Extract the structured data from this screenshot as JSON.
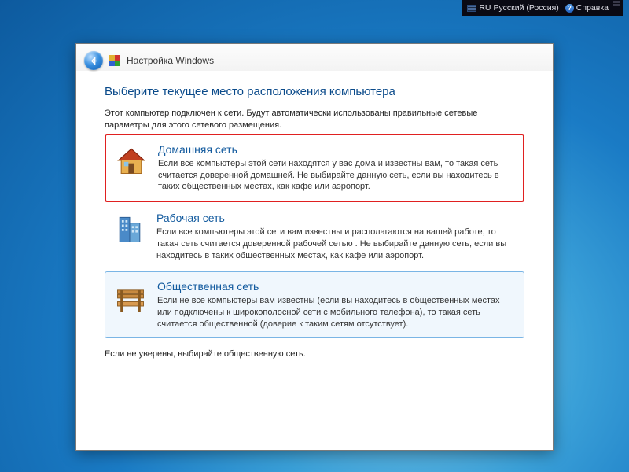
{
  "topbar": {
    "lang_code": "RU",
    "lang_label": "Русский (Россия)",
    "help_label": "Справка"
  },
  "dialog": {
    "title": "Настройка Windows",
    "heading": "Выберите текущее место расположения компьютера",
    "intro": "Этот компьютер подключен к сети. Будут автоматически использованы правильные сетевые параметры для этого сетевого размещения.",
    "options": [
      {
        "title": "Домашняя сеть",
        "desc": "Если все компьютеры этой сети находятся у вас дома и известны вам, то такая сеть считается доверенной домашней. Не выбирайте данную сеть, если вы находитесь в таких общественных местах, как кафе или аэропорт."
      },
      {
        "title": "Рабочая сеть",
        "desc": "Если все компьютеры этой сети вам известны и располагаются на вашей работе, то такая сеть считается доверенной рабочей сетью . Не выбирайте данную сеть, если вы находитесь в таких общественных местах, как кафе или аэропорт."
      },
      {
        "title": "Общественная сеть",
        "desc": "Если не все компьютеры вам известны (если вы находитесь в общественных местах или подключены к широкополосной сети с мобильного телефона), то такая сеть считается общественной (доверие к таким сетям отсутствует)."
      }
    ],
    "footnote": "Если не уверены, выбирайте общественную сеть."
  }
}
